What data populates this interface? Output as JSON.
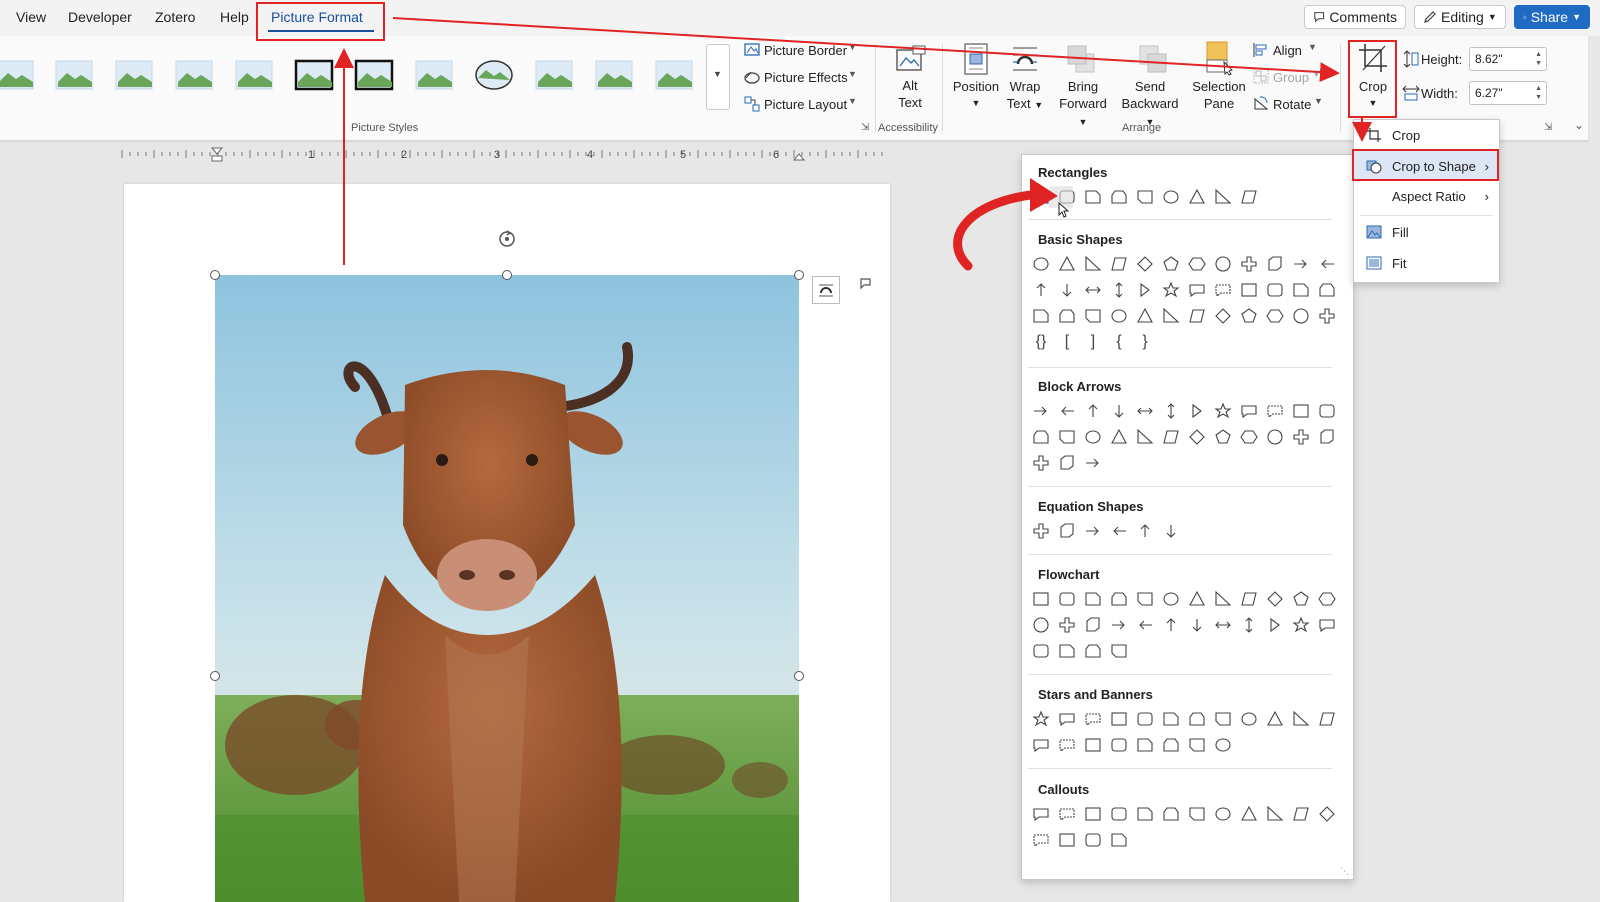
{
  "menubar": {
    "items": [
      "View",
      "Developer",
      "Zotero",
      "Help",
      "Picture Format"
    ],
    "comments_label": "Comments",
    "editing_label": "Editing",
    "share_label": "Share"
  },
  "ribbon": {
    "picture_border": "Picture Border",
    "picture_effects": "Picture Effects",
    "picture_layout": "Picture Layout",
    "picture_styles_label": "Picture Styles",
    "alt_text_line1": "Alt",
    "alt_text_line2": "Text",
    "accessibility_label": "Accessibility",
    "position_label": "Position",
    "wrap_line1": "Wrap",
    "wrap_line2": "Text",
    "bring_line1": "Bring",
    "bring_line2": "Forward",
    "send_line1": "Send",
    "send_line2": "Backward",
    "selection_line1": "Selection",
    "selection_line2": "Pane",
    "align_label": "Align",
    "group_label": "Group",
    "rotate_label": "Rotate",
    "arrange_label": "Arrange",
    "crop_label": "Crop",
    "height_label": "Height:",
    "height_value": "8.62\"",
    "width_label": "Width:",
    "width_value": "6.27\""
  },
  "ruler": {
    "numbers": [
      "1",
      "2",
      "3",
      "4",
      "5",
      "6"
    ]
  },
  "crop_menu": {
    "crop": "Crop",
    "crop_to_shape": "Crop to Shape",
    "aspect_ratio": "Aspect Ratio",
    "fill": "Fill",
    "fit": "Fit"
  },
  "shapes": {
    "rectangles": "Rectangles",
    "basic_shapes": "Basic Shapes",
    "block_arrows": "Block Arrows",
    "equation_shapes": "Equation Shapes",
    "flowchart": "Flowchart",
    "stars_and_banners": "Stars and Banners",
    "callouts": "Callouts",
    "basic_glyphs": [
      "{}",
      "[",
      "]",
      "{",
      "}"
    ],
    "rows": {
      "rectangles": [
        9
      ],
      "basic": [
        12,
        12,
        12
      ],
      "block_arrows": [
        12,
        12,
        3
      ],
      "equation": [
        6
      ],
      "flowchart": [
        12,
        12,
        4
      ],
      "stars": [
        12,
        8
      ],
      "callouts": [
        12,
        4
      ]
    }
  },
  "colors": {
    "accent_red": "#e02424",
    "brand_blue": "#1f6bc4",
    "tab_blue": "#1a4f9c"
  },
  "icons": {
    "picture_border": "picture-border-icon",
    "picture_effects": "picture-effects-icon",
    "picture_layout": "picture-layout-icon",
    "crop": "crop-icon",
    "fill": "fill-icon",
    "fit": "fit-icon"
  }
}
